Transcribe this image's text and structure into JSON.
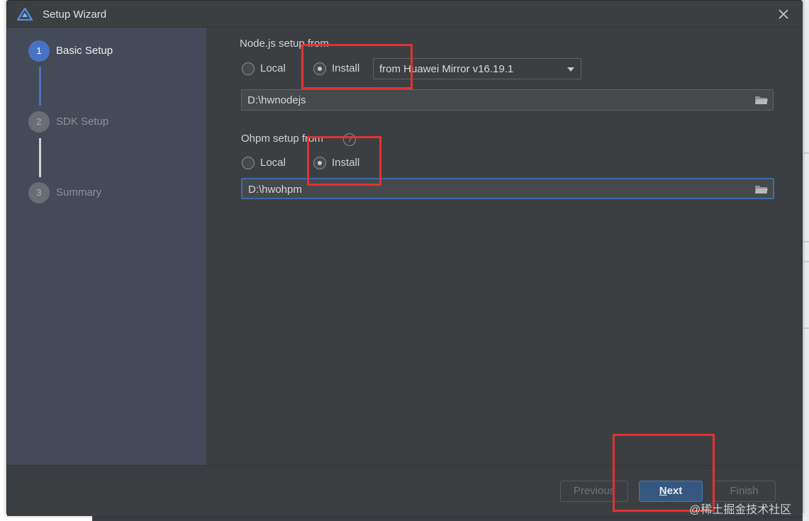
{
  "window": {
    "title": "Setup Wizard",
    "logo_icon": "harmonyos-triangle-logo",
    "close_icon": "close-icon"
  },
  "steps": [
    {
      "number": "1",
      "label": "Basic Setup",
      "state": "active"
    },
    {
      "number": "2",
      "label": "SDK Setup",
      "state": "inactive"
    },
    {
      "number": "3",
      "label": "Summary",
      "state": "inactive"
    }
  ],
  "nodejs": {
    "label": "Node.js setup from",
    "local_label": "Local",
    "install_label": "Install",
    "selected": "Install",
    "mirror_selected": "from Huawei Mirror v16.19.1",
    "path": "D:\\hwnodejs"
  },
  "ohpm": {
    "label": "Ohpm setup from",
    "help_glyph": "?",
    "local_label": "Local",
    "install_label": "Install",
    "selected": "Install",
    "path": "D:\\hwohpm"
  },
  "footer": {
    "previous": "Previous",
    "next_mnemonic": "N",
    "next_rest": "ext",
    "finish": "Finish"
  },
  "watermark": "@稀土掘金技术社区",
  "colors": {
    "dialog_bg": "#3c3f41",
    "sidebar_bg": "#454a58",
    "accent": "#4a72c2",
    "primary_button": "#365880",
    "highlight": "#e23232"
  }
}
